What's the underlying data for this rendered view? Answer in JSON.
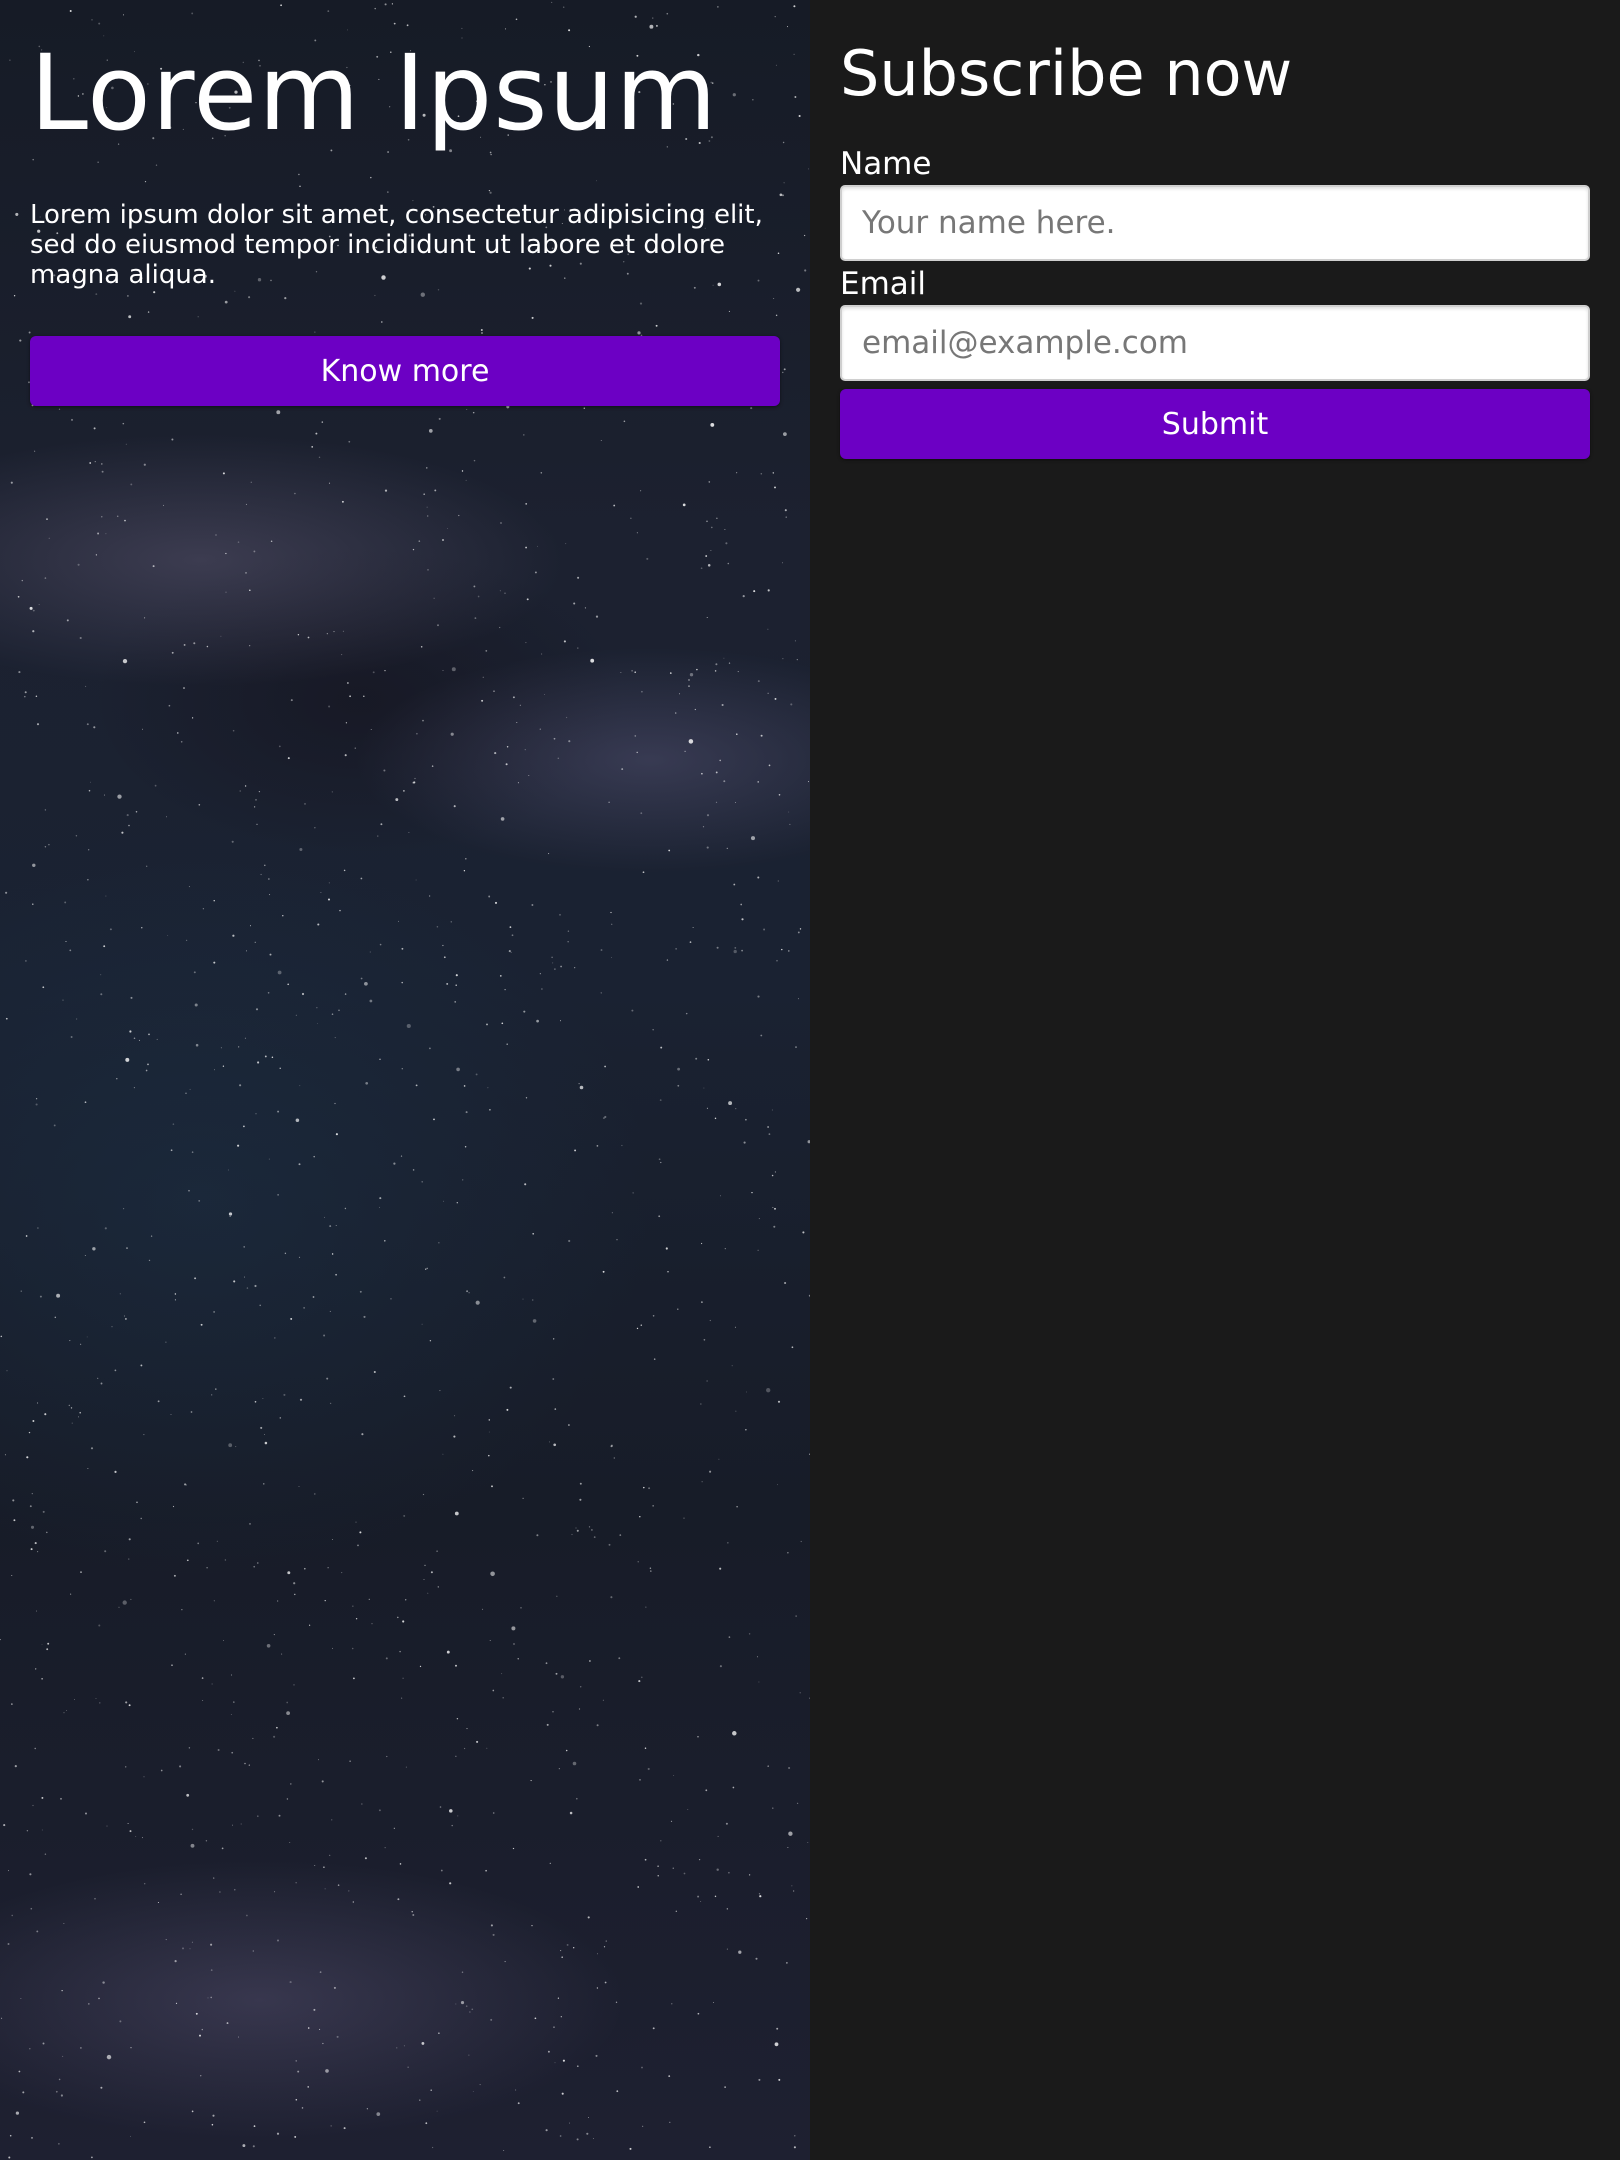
{
  "hero": {
    "title": "Lorem Ipsum",
    "text": "Lorem ipsum dolor sit amet, consectetur adipisicing elit, sed do eiusmod tempor incididunt ut labore et dolore magna aliqua.",
    "button_label": "Know more",
    "background": "starry night sky"
  },
  "subscribe": {
    "title": "Subscribe now",
    "name_label": "Name",
    "name_placeholder": "Your name here.",
    "email_label": "Email",
    "email_placeholder": "email@example.com",
    "submit_label": "Submit"
  },
  "colors": {
    "accent": "#6c00c4",
    "panel_bg": "#1a1a1a",
    "text": "#ffffff"
  }
}
